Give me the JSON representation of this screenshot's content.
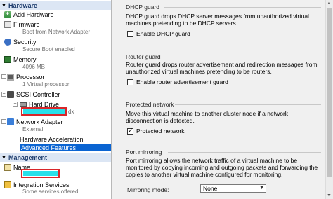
{
  "tree": {
    "hardware_header": "Hardware",
    "management_header": "Management",
    "items": {
      "add_hardware": "Add Hardware",
      "firmware": "Firmware",
      "firmware_sub": "Boot from Network Adapter",
      "security": "Security",
      "security_sub": "Secure Boot enabled",
      "memory": "Memory",
      "memory_sub": "4096 MB",
      "processor": "Processor",
      "processor_sub": "1 Virtual processor",
      "scsi": "SCSI Controller",
      "hard_drive": "Hard Drive",
      "hard_drive_suffix": "dx",
      "network": "Network Adapter",
      "network_sub": "External",
      "hw_accel": "Hardware Acceleration",
      "adv_features": "Advanced Features",
      "name": "Name",
      "integration": "Integration Services",
      "integration_sub": "Some services offered"
    }
  },
  "panel": {
    "dhcp": {
      "title": "DHCP guard",
      "desc": "DHCP guard drops DHCP server messages from unauthorized virtual machines pretending to be DHCP servers.",
      "checkbox": "Enable DHCP guard",
      "checked": false
    },
    "router": {
      "title": "Router guard",
      "desc": "Router guard drops router advertisement and redirection messages from unauthorized virtual machines pretending to be routers.",
      "checkbox": "Enable router advertisement guard",
      "checked": false
    },
    "protected": {
      "title": "Protected network",
      "desc": "Move this virtual machine to another cluster node if a network disconnection is detected.",
      "checkbox": "Protected network",
      "checked": true
    },
    "mirroring": {
      "title": "Port mirroring",
      "desc": "Port mirroring allows the network traffic of a virtual machine to be monitored by copying incoming and outgoing packets and forwarding the copies to another virtual machine configured for monitoring.",
      "mode_label": "Mirroring mode:",
      "mode_value": "None"
    }
  },
  "colors": {
    "selection": "#0a64d2",
    "header_bg": "#dce6f4",
    "redaction_border": "#d9262a",
    "redaction_fill": "#28e0ea"
  }
}
